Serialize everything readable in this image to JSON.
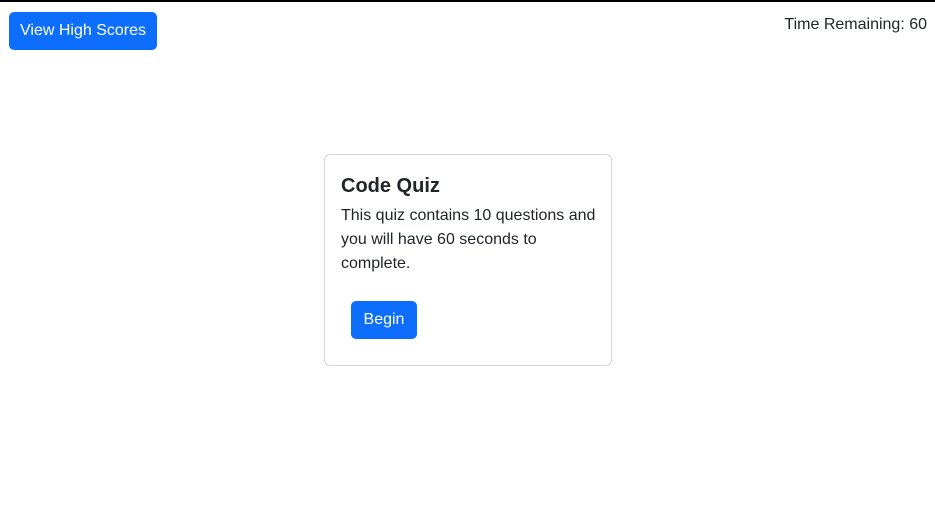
{
  "header": {
    "high_scores_label": "View High Scores",
    "timer_text": "Time Remaining: 60"
  },
  "card": {
    "title": "Code Quiz",
    "description": "This quiz contains 10 questions and you will have 60 seconds to complete.",
    "begin_label": "Begin"
  },
  "colors": {
    "primary": "#0d6efd",
    "text": "#212529",
    "card_border": "#d3d6d9"
  }
}
